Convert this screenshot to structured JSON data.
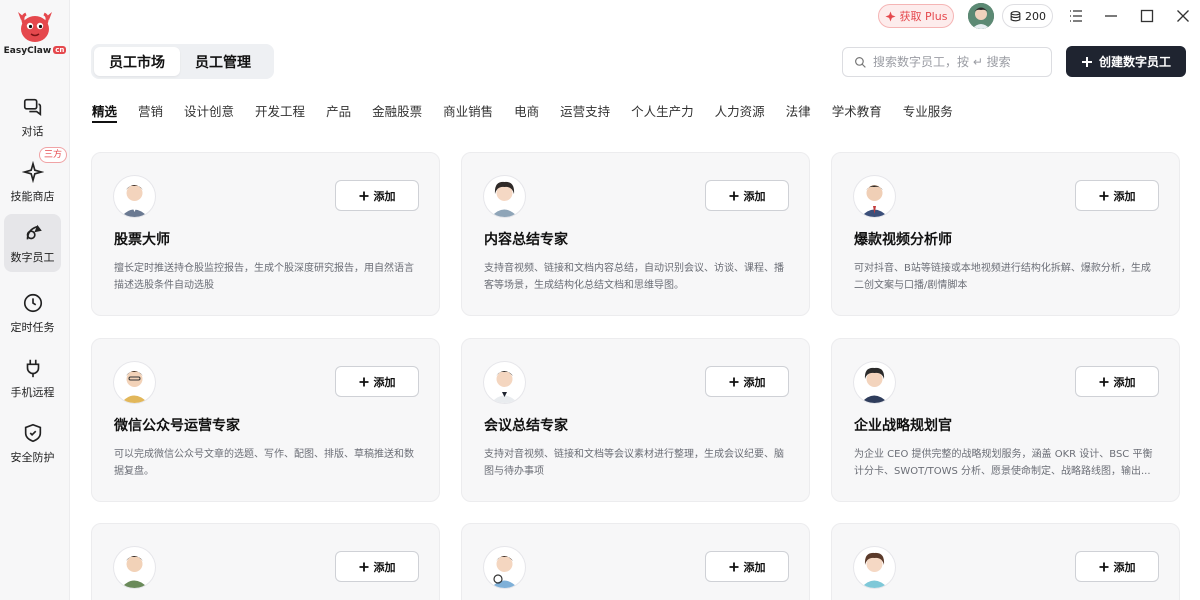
{
  "app": {
    "logo_text": "EasyClaw",
    "logo_badge": "cn"
  },
  "sidebar": {
    "items": [
      {
        "label": "对话",
        "icon": "chat-icon"
      },
      {
        "label": "技能商店",
        "icon": "sparkle-icon",
        "badge": "三方"
      },
      {
        "label": "数字员工",
        "icon": "digital-employee-icon",
        "active": true
      },
      {
        "label": "定时任务",
        "icon": "clock-icon"
      },
      {
        "label": "手机远程",
        "icon": "plug-icon"
      },
      {
        "label": "安全防护",
        "icon": "shield-icon"
      }
    ]
  },
  "topbar": {
    "plus_label": "获取 Plus",
    "credits": "200"
  },
  "main_tabs": [
    {
      "label": "员工市场",
      "active": true
    },
    {
      "label": "员工管理",
      "active": false
    }
  ],
  "search": {
    "placeholder": "搜索数字员工，按 ↵ 搜索"
  },
  "create_button": "创建数字员工",
  "categories": [
    {
      "label": "精选",
      "active": true
    },
    {
      "label": "营销"
    },
    {
      "label": "设计创意"
    },
    {
      "label": "开发工程"
    },
    {
      "label": "产品"
    },
    {
      "label": "金融股票"
    },
    {
      "label": "商业销售"
    },
    {
      "label": "电商"
    },
    {
      "label": "运营支持"
    },
    {
      "label": "个人生产力"
    },
    {
      "label": "人力资源"
    },
    {
      "label": "法律"
    },
    {
      "label": "学术教育"
    },
    {
      "label": "专业服务"
    }
  ],
  "add_label": "添加",
  "employees": [
    {
      "name": "股票大师",
      "desc": "擅长定时推送持仓股监控报告，生成个股深度研究报告，用自然语言描述选股条件自动选股"
    },
    {
      "name": "内容总结专家",
      "desc": "支持音视频、链接和文档内容总结，自动识别会议、访谈、课程、播客等场景，生成结构化总结文档和思维导图。"
    },
    {
      "name": "爆款视频分析师",
      "desc": "可对抖音、B站等链接或本地视频进行结构化拆解、爆款分析，生成二创文案与口播/剧情脚本"
    },
    {
      "name": "微信公众号运营专家",
      "desc": "可以完成微信公众号文章的选题、写作、配图、排版、草稿推送和数据复盘。"
    },
    {
      "name": "会议总结专家",
      "desc": "支持对音视频、链接和文档等会议素材进行整理，生成会议纪要、脑图与待办事项"
    },
    {
      "name": "企业战略规划官",
      "desc": "为企业 CEO 提供完整的战略规划服务，涵盖 OKR 设计、BSC 平衡计分卡、SWOT/TOWS 分析、愿景使命制定、战略路线图，输出..."
    },
    {
      "name": "",
      "desc": ""
    },
    {
      "name": "",
      "desc": ""
    },
    {
      "name": "",
      "desc": ""
    }
  ],
  "colors": {
    "accent_dark": "#1f2430",
    "brand_red": "#e5484d",
    "card_bg": "#f7f7f8"
  }
}
